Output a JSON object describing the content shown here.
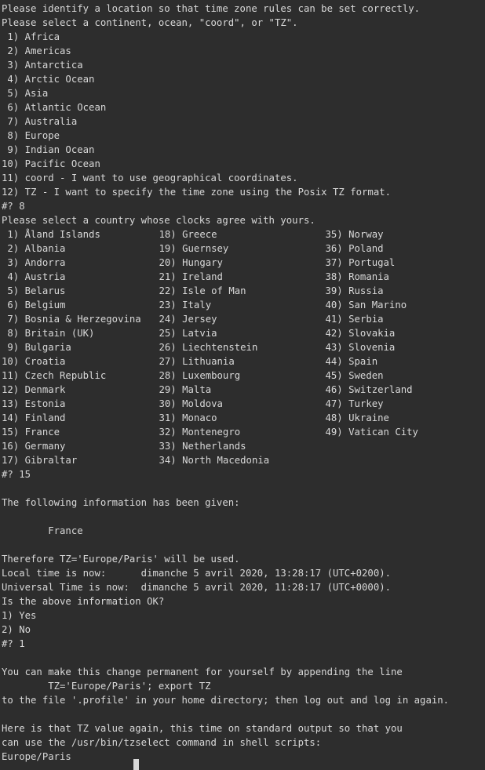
{
  "terminal": {
    "background_color": "#2d2d2d",
    "text_color": "#d8d8d8",
    "cursor_color": "#d8d8d8",
    "prompt_symbol": "#?",
    "intro": {
      "line1": "Please identify a location so that time zone rules can be set correctly.",
      "line2": "Please select a continent, ocean, \"coord\", or \"TZ\"."
    },
    "continent_menu": {
      "items": [
        " 1) Africa",
        " 2) Americas",
        " 3) Antarctica",
        " 4) Arctic Ocean",
        " 5) Asia",
        " 6) Atlantic Ocean",
        " 7) Australia",
        " 8) Europe",
        " 9) Indian Ocean",
        "10) Pacific Ocean",
        "11) coord - I want to use geographical coordinates.",
        "12) TZ - I want to specify the time zone using the Posix TZ format."
      ],
      "prompt": "#? 8",
      "answer": "8"
    },
    "country_prompt": "Please select a country whose clocks agree with yours.",
    "country_menu": {
      "rows": [
        [
          " 1) Åland Islands",
          "18) Greece",
          "35) Norway"
        ],
        [
          " 2) Albania",
          "19) Guernsey",
          "36) Poland"
        ],
        [
          " 3) Andorra",
          "20) Hungary",
          "37) Portugal"
        ],
        [
          " 4) Austria",
          "21) Ireland",
          "38) Romania"
        ],
        [
          " 5) Belarus",
          "22) Isle of Man",
          "39) Russia"
        ],
        [
          " 6) Belgium",
          "23) Italy",
          "40) San Marino"
        ],
        [
          " 7) Bosnia & Herzegovina",
          "24) Jersey",
          "41) Serbia"
        ],
        [
          " 8) Britain (UK)",
          "25) Latvia",
          "42) Slovakia"
        ],
        [
          " 9) Bulgaria",
          "26) Liechtenstein",
          "43) Slovenia"
        ],
        [
          "10) Croatia",
          "27) Lithuania",
          "44) Spain"
        ],
        [
          "11) Czech Republic",
          "28) Luxembourg",
          "45) Sweden"
        ],
        [
          "12) Denmark",
          "29) Malta",
          "46) Switzerland"
        ],
        [
          "13) Estonia",
          "30) Moldova",
          "47) Turkey"
        ],
        [
          "14) Finland",
          "31) Monaco",
          "48) Ukraine"
        ],
        [
          "15) France",
          "32) Montenegro",
          "49) Vatican City"
        ],
        [
          "16) Germany",
          "33) Netherlands",
          ""
        ],
        [
          "17) Gibraltar",
          "34) North Macedonia",
          ""
        ]
      ],
      "prompt": "#? 15",
      "answer": "15"
    },
    "summary": {
      "heading": "The following information has been given:",
      "value": "        France",
      "therefore": "Therefore TZ='Europe/Paris' will be used.",
      "local_time": "Local time is now:      dimanche 5 avril 2020, 13:28:17 (UTC+0200).",
      "universal_time": "Universal Time is now:  dimanche 5 avril 2020, 11:28:17 (UTC+0000).",
      "confirm_question": "Is the above information OK?",
      "options": [
        "1) Yes",
        "2) No"
      ],
      "prompt": "#? 1",
      "answer": "1"
    },
    "footer": {
      "permanent_line1": "You can make this change permanent for yourself by appending the line",
      "permanent_line2": "        TZ='Europe/Paris'; export TZ",
      "permanent_line3": "to the file '.profile' in your home directory; then log out and log in again.",
      "stdout_line1": "Here is that TZ value again, this time on standard output so that you",
      "stdout_line2": "can use the /usr/bin/tzselect command in shell scripts:",
      "tz_value": "Europe/Paris"
    }
  }
}
